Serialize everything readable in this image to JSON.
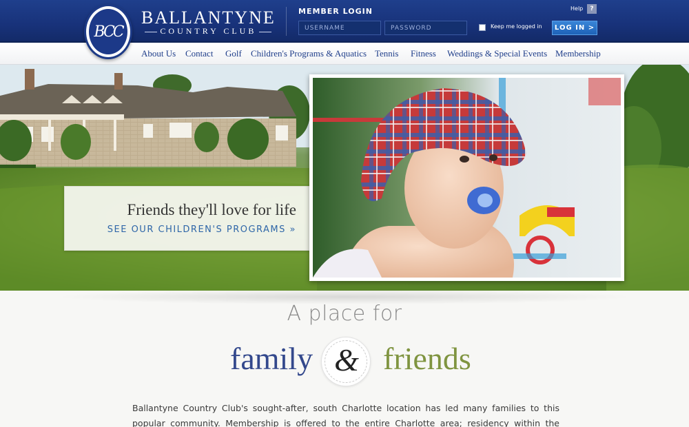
{
  "header": {
    "logo_monogram": "BCC",
    "brand_name": "BALLANTYNE",
    "brand_sub": "COUNTRY CLUB",
    "member_login_title": "MEMBER LOGIN",
    "username_placeholder": "USERNAME",
    "password_placeholder": "PASSWORD",
    "keep_logged_in_label": "Keep me logged in",
    "login_button_label": "LOG IN  >",
    "help_label": "Help",
    "help_icon": "?"
  },
  "nav": {
    "items": [
      {
        "label": "About Us"
      },
      {
        "label": "Contact"
      },
      {
        "label": "Golf"
      },
      {
        "label": "Children's Programs & Aquatics"
      },
      {
        "label": "Tennis"
      },
      {
        "label": "Fitness"
      },
      {
        "label": "Weddings & Special Events"
      },
      {
        "label": "Membership"
      }
    ]
  },
  "hero": {
    "promo_title": "Friends they'll love for life",
    "promo_link": "SEE OUR CHILDREN'S PROGRAMS »"
  },
  "intro": {
    "tagline": "A place for",
    "word_left": "family",
    "ampersand": "&",
    "word_right": "friends",
    "paragraph": "Ballantyne Country Club's sought-after, south Charlotte location has led many families to this popular community. Membership is offered to the entire Charlotte area; residency within the community is not a"
  },
  "colors": {
    "header_blue": "#1b3a80",
    "nav_text": "#1f3e8a",
    "link_blue": "#2f66a8",
    "family_blue": "#33488c",
    "friends_green": "#7f9440"
  }
}
